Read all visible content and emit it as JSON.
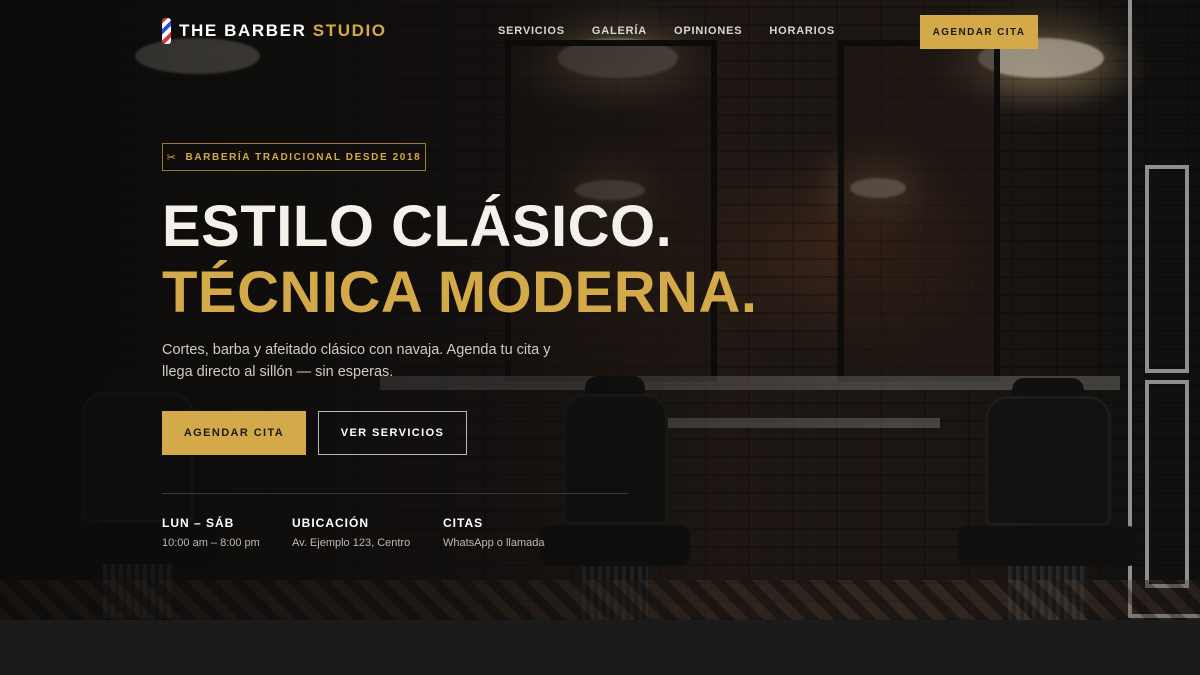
{
  "brand": {
    "prefix": "THE BARBER",
    "highlight": "STUDIO",
    "logo_icon": "barber-pole-icon"
  },
  "nav": {
    "items": [
      {
        "label": "SERVICIOS"
      },
      {
        "label": "GALERÍA"
      },
      {
        "label": "OPINIONES"
      },
      {
        "label": "HORARIOS"
      }
    ],
    "cta_label": "AGENDAR CITA"
  },
  "hero": {
    "badge": {
      "icon": "scissors-icon",
      "glyph": "✂",
      "text": "BARBERÍA TRADICIONAL DESDE 2018"
    },
    "title_line1": "ESTILO CLÁSICO.",
    "title_line2": "TÉCNICA MODERNA.",
    "lead": "Cortes, barba y afeitado clásico con navaja. Agenda tu cita y llega directo al sillón — sin esperas.",
    "primary_button": "AGENDAR CITA",
    "secondary_button": "VER SERVICIOS",
    "info": [
      {
        "title": "LUN – SÁB",
        "value": "10:00 am – 8:00 pm"
      },
      {
        "title": "UBICACIÓN",
        "value": "Av. Ejemplo 123, Centro"
      },
      {
        "title": "CITAS",
        "value": "WhatsApp o llamada"
      }
    ]
  },
  "colors": {
    "accent": "#d4a94a",
    "background": "#1b1b1c",
    "text": "#f4f1ea"
  }
}
